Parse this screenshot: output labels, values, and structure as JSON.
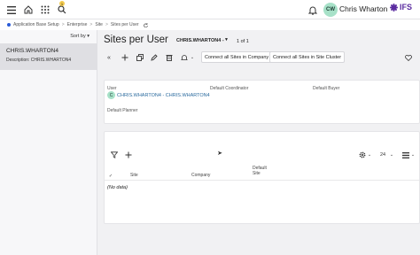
{
  "topbar": {
    "user_name": "Chris Wharton",
    "avatar_initials": "CW",
    "logo_text": "IFS",
    "notification_badge": "1"
  },
  "breadcrumb": {
    "items": [
      "Application Base Setup",
      "Enterprise",
      "Site",
      "Sites per User"
    ],
    "separator": ">"
  },
  "sidebar": {
    "sort_label": "Sort by",
    "item": {
      "title": "CHRIS.WHARTON4",
      "description_label": "Description:",
      "description_value": "CHRIS.WHARTON4"
    }
  },
  "main": {
    "title": "Sites per User",
    "record_user": "CHRIS.WHARTON4 -",
    "pager": "1 of 1",
    "toolbar": {
      "connect_company": "Connect all Sites in Company",
      "connect_cluster": "Connect all Sites in Site Cluster"
    },
    "details": {
      "user_label": "User",
      "user_chip": "C",
      "user_value": "CHRIS.WHARTON4 - CHRIS.WHARTON4",
      "default_coordinator_label": "Default Coordinator",
      "default_buyer_label": "Default Buyer",
      "default_planner_label": "Default Planner"
    },
    "table": {
      "page_size": "24",
      "columns": [
        "Site",
        "Company",
        "Default Site"
      ],
      "empty_text": "(No data)"
    }
  },
  "colors": {
    "brand": "#5b2ca0",
    "avatar": "#a7e1c8",
    "link": "#2a6a9e",
    "badge": "#f2c94c"
  }
}
